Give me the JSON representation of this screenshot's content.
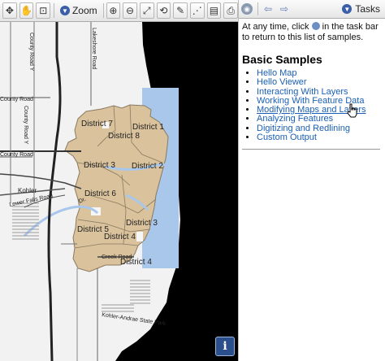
{
  "map_toolbar": {
    "tools": [
      {
        "name": "pan-icon",
        "glyph": "✥"
      },
      {
        "name": "grab-icon",
        "glyph": "✋"
      },
      {
        "name": "zoom-box-icon",
        "glyph": "⊡"
      }
    ],
    "zoom_label": "Zoom",
    "tools_right": [
      {
        "name": "zoom-in-icon",
        "glyph": "⊕"
      },
      {
        "name": "zoom-out-icon",
        "glyph": "⊖"
      },
      {
        "name": "full-extent-icon",
        "glyph": "⤢"
      },
      {
        "name": "previous-extent-icon",
        "glyph": "⟲"
      },
      {
        "name": "select-icon",
        "glyph": "✎"
      },
      {
        "name": "measure-icon",
        "glyph": "⋰"
      },
      {
        "name": "layers-icon",
        "glyph": "▤"
      },
      {
        "name": "print-icon",
        "glyph": "⎙"
      }
    ]
  },
  "map": {
    "district_labels": [
      "District 7",
      "District 1",
      "District 8",
      "District 3",
      "District 2",
      "District 6",
      "District 3",
      "District 5",
      "District 4",
      "District 4"
    ],
    "road_labels": [
      "County Road Y",
      "Lakeshore Road",
      "County Road",
      "County Road Y",
      "County Road",
      "Kohler",
      "Lower Falls Road",
      "Creek Road",
      "Kohler-Andrae State Park",
      "Dr."
    ],
    "colors": {
      "land": "#f1f1f1",
      "lake": "#000000",
      "district": "#d9c29c",
      "district_border": "#8a7a60",
      "water": "#a9c7ea"
    }
  },
  "task_pane": {
    "header": {
      "tasks_label": "Tasks",
      "back_icon": "arrow-left-icon",
      "forward_icon": "arrow-right-icon",
      "home_icon": "globe-icon"
    },
    "intro_before": "At any time, click",
    "intro_after": "in the task bar to return to this list of samples.",
    "title": "Basic Samples",
    "samples": [
      "Hello Map",
      "Hello Viewer",
      "Interacting With Layers",
      "Working With Feature Data",
      "Modifying Maps and Layers",
      "Analyzing Features",
      "Digitizing and Redlining",
      "Custom Output"
    ],
    "hovered_sample": "Modifying Maps and Layers"
  },
  "info_button": "i"
}
